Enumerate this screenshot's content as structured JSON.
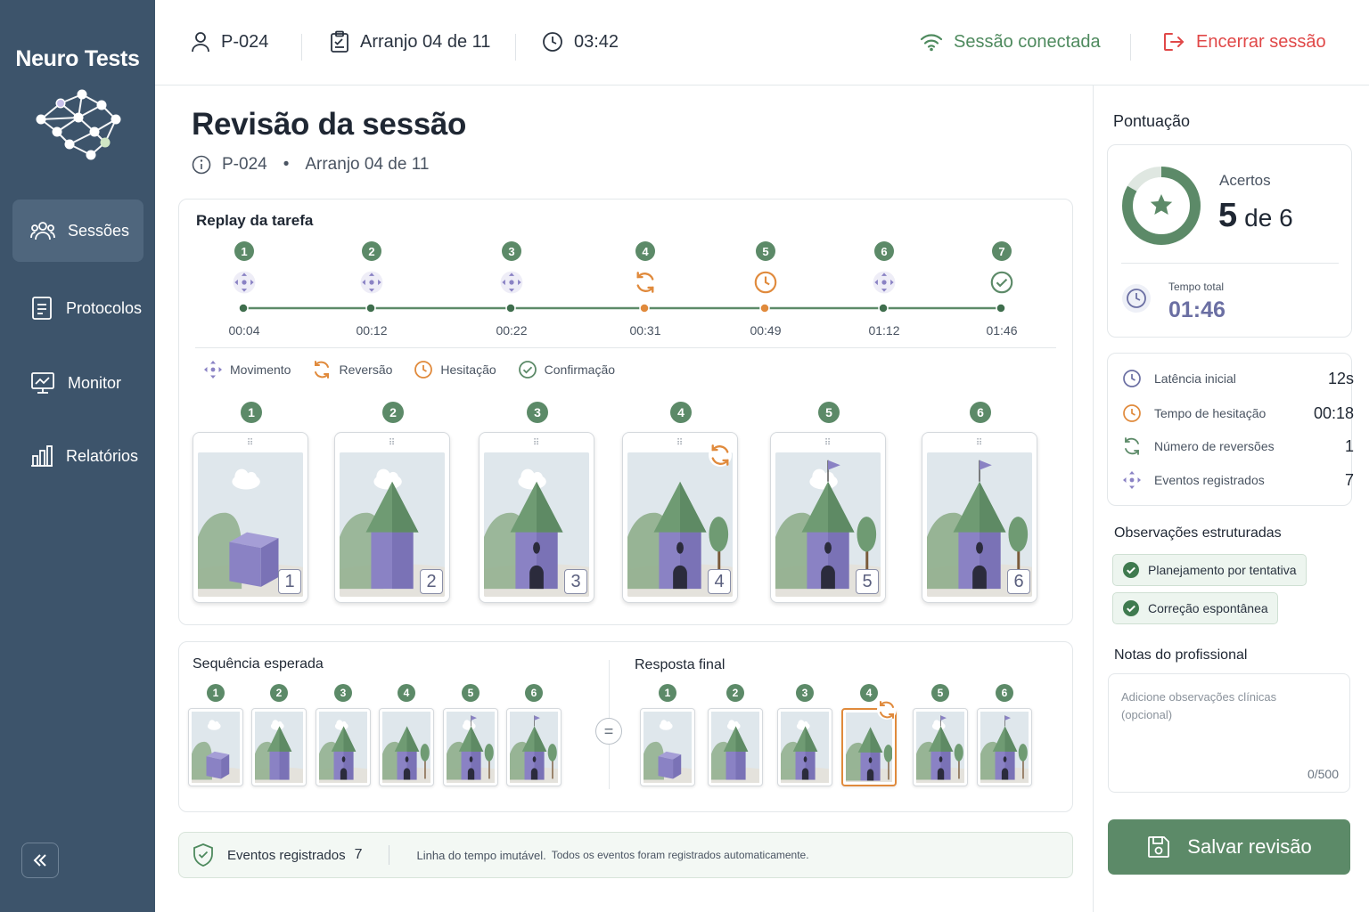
{
  "app": {
    "brand": "Neuro Tests"
  },
  "sidebar": {
    "items": [
      {
        "label": "Sessões",
        "icon": "users-icon",
        "active": true
      },
      {
        "label": "Protocolos",
        "icon": "document-icon",
        "active": false
      },
      {
        "label": "Monitor",
        "icon": "monitor-icon",
        "active": false
      },
      {
        "label": "Relatórios",
        "icon": "bar-chart-icon",
        "active": false
      }
    ],
    "collapse_icon": "double-chevron-left-icon"
  },
  "topbar": {
    "participant": "P-024",
    "arrangement": "Arranjo 04 de 11",
    "timer": "03:42",
    "connection": "Sessão conectada",
    "end_session": "Encerrar sessão"
  },
  "page": {
    "title": "Revisão da sessão",
    "participant": "P-024",
    "separator": "•",
    "arrangement": "Arranjo 04 de 11"
  },
  "replay": {
    "title": "Replay da tarefa",
    "events": [
      {
        "n": "1",
        "type": "movimento",
        "time": "00:04"
      },
      {
        "n": "2",
        "type": "movimento",
        "time": "00:12"
      },
      {
        "n": "3",
        "type": "movimento",
        "time": "00:22"
      },
      {
        "n": "4",
        "type": "reversao",
        "time": "00:31"
      },
      {
        "n": "5",
        "type": "hesitacao",
        "time": "00:49"
      },
      {
        "n": "6",
        "type": "movimento",
        "time": "01:12"
      },
      {
        "n": "7",
        "type": "confirmacao",
        "time": "01:46"
      }
    ],
    "legend": [
      "Movimento",
      "Reversão",
      "Hesitação",
      "Confirmação"
    ],
    "frames": [
      "1",
      "2",
      "3",
      "4",
      "5",
      "6"
    ]
  },
  "sequence": {
    "expected_title": "Sequência esperada",
    "final_title": "Resposta final",
    "badges": [
      "1",
      "2",
      "3",
      "4",
      "5",
      "6"
    ],
    "equals": "="
  },
  "footer": {
    "label": "Eventos registrados",
    "count": "7",
    "immutable": "Linha do tempo imutável.",
    "note": "Todos os eventos foram registrados automaticamente."
  },
  "score": {
    "title": "Pontuação",
    "hits_label": "Acertos",
    "hits_value": "5",
    "hits_of": "de 6",
    "hits_fraction": 0.8333,
    "total_time_label": "Tempo total",
    "total_time": "01:46"
  },
  "stats": [
    {
      "label": "Latência inicial",
      "value": "12s",
      "icon": "clock-icon"
    },
    {
      "label": "Tempo de hesitação",
      "value": "00:18",
      "icon": "clock-orange-icon"
    },
    {
      "label": "Número de reversões",
      "value": "1",
      "icon": "refresh-icon"
    },
    {
      "label": "Eventos registrados",
      "value": "7",
      "icon": "move-icon"
    }
  ],
  "observations": {
    "title": "Observações estruturadas",
    "chips": [
      "Planejamento por tentativa",
      "Correção espontânea"
    ]
  },
  "notes": {
    "title": "Notas do profissional",
    "placeholder": "Adicione observações clínicas (opcional)",
    "counter": "0/500"
  },
  "save_label": "Salvar revisão",
  "colors": {
    "sidebar": "#3d546b",
    "accent_green": "#5c8a68",
    "warning_orange": "#e08a3c",
    "danger_red": "#e04848",
    "purple": "#8a82c4"
  }
}
